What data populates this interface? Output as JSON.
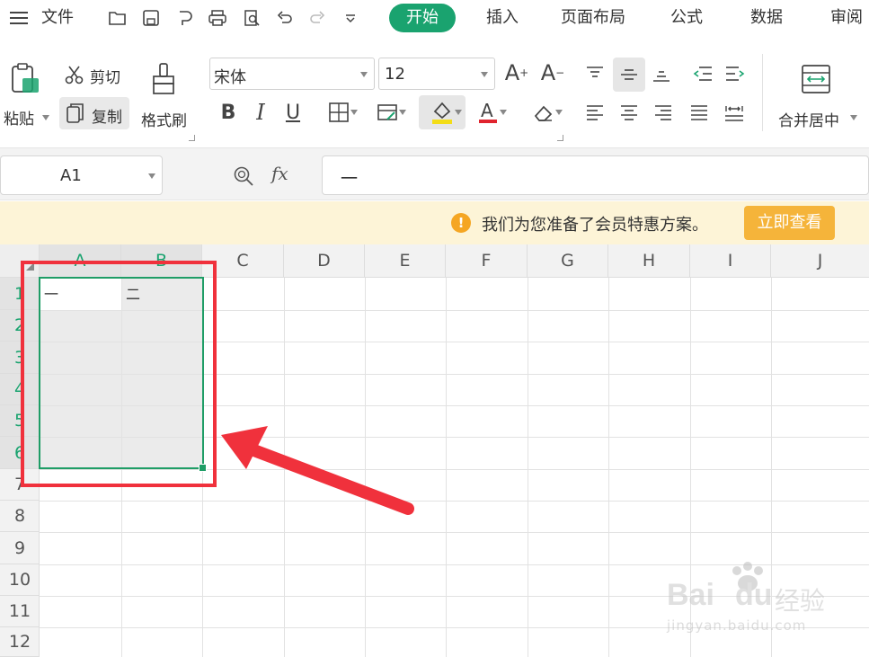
{
  "menu": {
    "file_label": "文件",
    "tabs": [
      "开始",
      "插入",
      "页面布局",
      "公式",
      "数据",
      "审阅"
    ],
    "active_tab": "开始"
  },
  "ribbon": {
    "paste_label": "粘贴",
    "cut_label": "剪切",
    "copy_label": "复制",
    "format_painter_label": "格式刷",
    "font_name": "宋体",
    "font_size": "12",
    "merge_center_label": "合并居中"
  },
  "formula_bar": {
    "cell_ref": "A1",
    "fx_label": "fx",
    "value": "一"
  },
  "notice": {
    "text": "我们为您准备了会员特惠方案。",
    "button_label": "立即查看"
  },
  "grid": {
    "columns": [
      "A",
      "B",
      "C",
      "D",
      "E",
      "F",
      "G",
      "H",
      "I",
      "J"
    ],
    "rows": [
      "1",
      "2",
      "3",
      "4",
      "5",
      "6",
      "7",
      "8",
      "9",
      "10",
      "11",
      "12"
    ],
    "cells": {
      "A1": "一",
      "B1": "二"
    }
  },
  "watermark": {
    "brand": "Bai",
    "brand_tail": "du",
    "cn": "经验",
    "url": "jingyan.baidu.com"
  },
  "colors": {
    "accent": "#1aa36f",
    "selection_border": "#1f9d66",
    "annotation_red": "#f0313c",
    "notice_bg": "#fdf4d7",
    "notice_btn": "#f5b43a"
  }
}
